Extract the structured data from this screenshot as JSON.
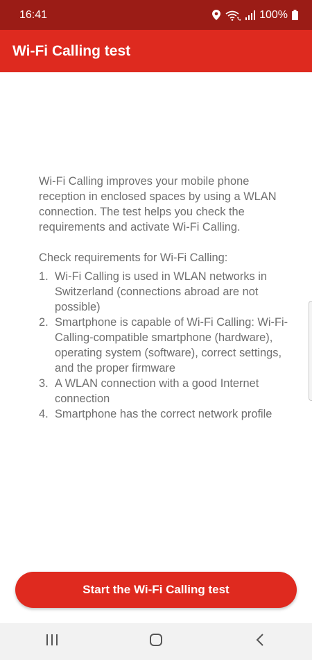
{
  "status_bar": {
    "time": "16:41",
    "battery": "100%",
    "icons": [
      "location-icon",
      "wifi-calling-icon",
      "signal-icon",
      "battery-icon"
    ]
  },
  "app_bar": {
    "title": "Wi-Fi Calling test"
  },
  "content": {
    "intro": "Wi-Fi Calling improves your mobile phone reception in enclosed spaces by using a WLAN connection. The test helps you check the requirements and activate Wi-Fi Calling.",
    "requirements_heading": "Check requirements for Wi-Fi Calling:",
    "requirements": [
      {
        "num": "1.",
        "text": "Wi-Fi Calling is used in WLAN networks in Switzerland (connections abroad are not possible)"
      },
      {
        "num": "2.",
        "text": "Smartphone is capable of Wi-Fi Calling: Wi-Fi-Calling-compatible smartphone (hardware), operating system (software), correct settings, and the proper firmware"
      },
      {
        "num": "3.",
        "text": "A WLAN connection with a good Internet connection"
      },
      {
        "num": "4.",
        "text": "Smartphone has the correct network profile"
      }
    ]
  },
  "action": {
    "start_label": "Start the Wi-Fi Calling test"
  },
  "nav_bar": {
    "icons": [
      "recent-apps-icon",
      "home-icon",
      "back-icon"
    ]
  },
  "colors": {
    "status_bar": "#9b1c16",
    "app_bar": "#de2a1f",
    "button": "#df2a1f",
    "body_text": "#6f6f6f"
  }
}
